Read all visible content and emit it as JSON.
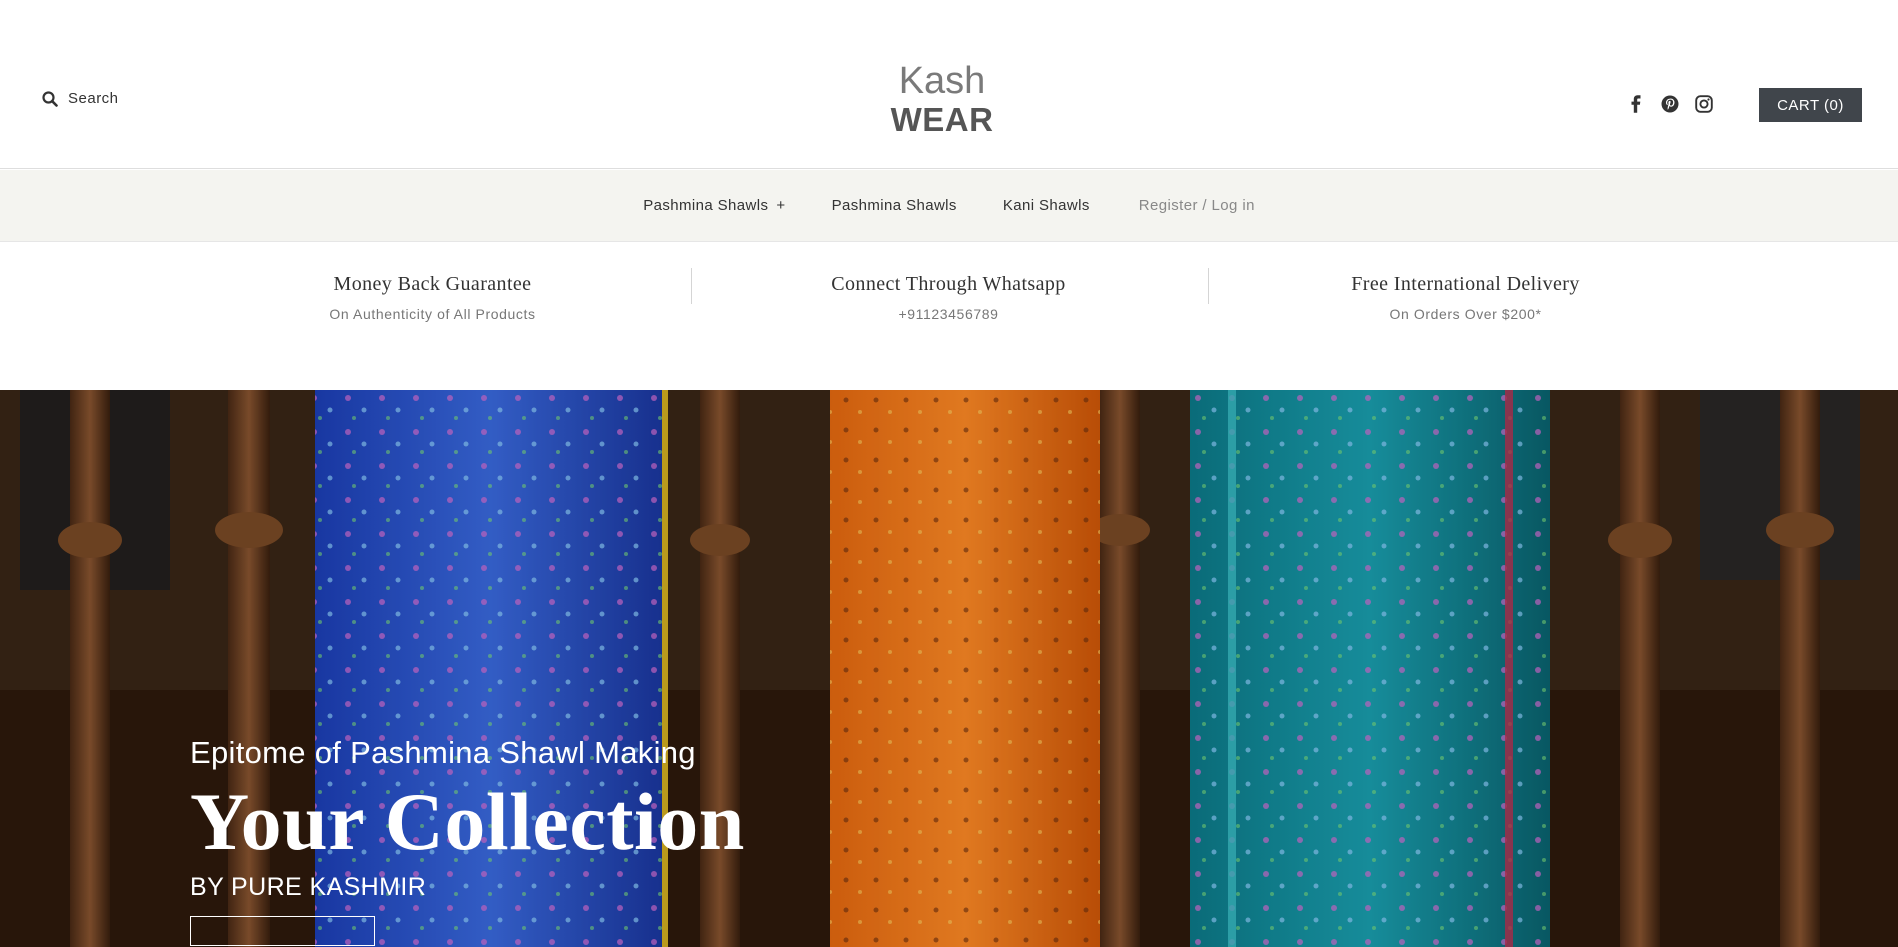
{
  "header": {
    "search_label": "Search",
    "logo_line1": "Kash",
    "logo_line2": "WEAR",
    "cart_label": "CART (0)",
    "social_icons": [
      "facebook-icon",
      "pinterest-icon",
      "instagram-icon"
    ]
  },
  "nav": {
    "items": [
      {
        "label": "Pashmina Shawls",
        "suffix": "+"
      },
      {
        "label": "Pashmina Shawls"
      },
      {
        "label": "Kani Shawls"
      },
      {
        "label": "Register / Log in"
      }
    ]
  },
  "features": [
    {
      "title": "Money Back Guarantee",
      "subtitle": "On Authenticity of All Products"
    },
    {
      "title": "Connect Through Whatsapp",
      "subtitle": "+91123456789"
    },
    {
      "title": "Free International Delivery",
      "subtitle": "On Orders Over $200*"
    }
  ],
  "hero": {
    "tagline": "Epitome of Pashmina Shawl Making",
    "title": "Your Collection",
    "subtitle": "BY PURE KASHMIR"
  },
  "colors": {
    "cart_bg": "#40454b",
    "nav_bg": "#f4f4f0",
    "hero_bg": "#3b2414"
  }
}
